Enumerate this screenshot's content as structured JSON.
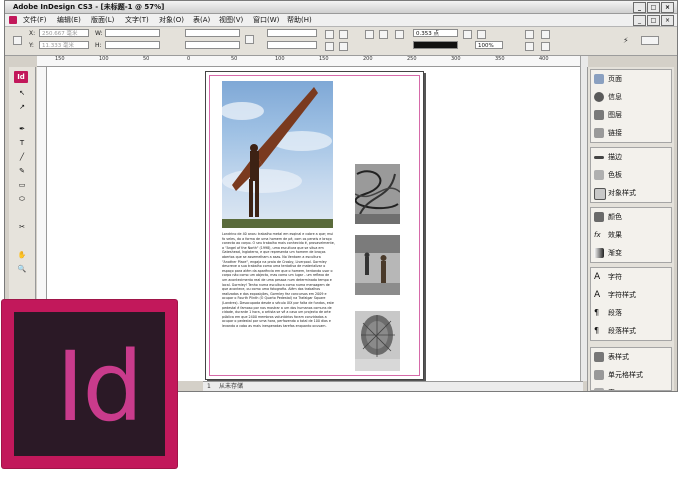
{
  "window": {
    "title": "Adobe InDesign CS3 - [未标题-1 @ 57%]",
    "controls": [
      "_",
      "□",
      "×"
    ],
    "doc_controls": [
      "_",
      "□",
      "×"
    ]
  },
  "menu": [
    "文件(F)",
    "编辑(E)",
    "版面(L)",
    "文字(T)",
    "对象(O)",
    "表(A)",
    "视图(V)",
    "窗口(W)",
    "帮助(H)"
  ],
  "control_panel": {
    "x_label": "X:",
    "y_label": "Y:",
    "w_label": "W:",
    "h_label": "H:",
    "x_value": "250.667 毫米",
    "y_value": "11.333 毫米",
    "stroke_weight": "0.353 点",
    "zoom_percent": "100%"
  },
  "ruler": {
    "ticks": [
      "150",
      "100",
      "50",
      "0",
      "50",
      "100",
      "150",
      "200",
      "250",
      "300",
      "350",
      "400"
    ]
  },
  "status_bar": {
    "page_number": "1",
    "state": "从未存储"
  },
  "document": {
    "paragraph": "Londrino de 40 anos: trabalho metal em esqinal e cobre a que; mui fo veles, do a forma de uma homem de pé, com os peneis e braço conecta ao corpo. O seu trabalho mais conhecido é, provavelmente, a \"Angel of the North\" (1998), uma escultura que se situa em Gateshead, Inglaterra, e que representa um homem de braços abertos que se assemelham a asas. No Ventoen a escultura \"Another Place\", engaja na praia de Crosby, Liverpool. Gormley descreve a sua trabalho como uma tentativa de materializar o espaço para além da aparência em que o homem, tentando usar o corpo não como um objecto, mas como um lugar - um reflexo de um acontecimento real de uma pessoa num determinado tempo e local. Gormley! Tenho numa escultura como numa mensagem de que acontece, ou como uma fotografia. Além dos trabalhos realizados e dos exposições, Gormley fez concursos em 2009 e ocupar o Fourth Plinth (O Quarto Pedestal) na Trafalgar Square (Londres). Desocupada desde o século XIX por falta de fundos, este pedestal é famoso por nos mostrar a um dos humanos comuns de cidade, durante 1 hora, o artista se vê a casa um projecto de arte pública em que 2400 membros voluntários foram convidados a ocupar o pedestal por uma hora, perfazendo o total de 100 dias e levando a cabo as mais inesperadas tarefas enquanto ocuvam."
  },
  "panels": {
    "group1": [
      "页面",
      "信息",
      "图层",
      "链接"
    ],
    "group2": [
      "描边",
      "色板",
      "对象样式"
    ],
    "group3": [
      "颜色",
      "效果",
      "渐变"
    ],
    "group4": [
      "字符",
      "字符样式",
      "段落",
      "段落样式"
    ],
    "group5": [
      "表样式",
      "单元格样式",
      "表"
    ]
  },
  "tools": [
    "Id",
    "↖",
    "↗",
    "✒",
    "T",
    "╱",
    "✎",
    "▭",
    "⬭",
    "✂",
    "✋",
    "🔍"
  ],
  "logo": {
    "text": "Id",
    "color": "#c2185b",
    "background": "#2b1926",
    "text_color": "#c93b8c"
  }
}
